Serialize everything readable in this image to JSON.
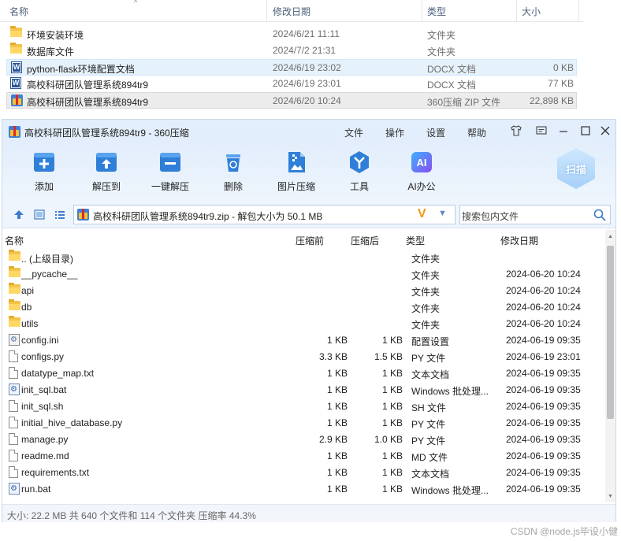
{
  "explorer": {
    "columns": {
      "name": "名称",
      "modified": "修改日期",
      "type": "类型",
      "size": "大小"
    },
    "rows": [
      {
        "icon": "folder-icon",
        "name": "环境安装环境",
        "modified": "2024/6/21 11:11",
        "type": "文件夹",
        "size": ""
      },
      {
        "icon": "folder-icon",
        "name": "数据库文件",
        "modified": "2024/7/2 21:31",
        "type": "文件夹",
        "size": ""
      },
      {
        "icon": "word-doc-icon",
        "name": "python-flask环境配置文档",
        "modified": "2024/6/19 23:02",
        "type": "DOCX 文档",
        "size": "0 KB",
        "selected": true
      },
      {
        "icon": "word-doc-icon",
        "name": "高校科研团队管理系统894tr9",
        "modified": "2024/6/19 23:01",
        "type": "DOCX 文档",
        "size": "77 KB"
      },
      {
        "icon": "zip-archive-icon",
        "name": "高校科研团队管理系统894tr9",
        "modified": "2024/6/20 10:24",
        "type": "360压缩 ZIP 文件",
        "size": "22,898 KB",
        "highlighted": true
      }
    ]
  },
  "app": {
    "title": "高校科研团队管理系统894tr9 - 360压缩",
    "menu": [
      "文件",
      "操作",
      "设置",
      "帮助"
    ],
    "toolbar": [
      {
        "label": "添加",
        "icon": "add-icon"
      },
      {
        "label": "解压到",
        "icon": "extract-to-icon"
      },
      {
        "label": "一键解压",
        "icon": "one-click-extract-icon"
      },
      {
        "label": "删除",
        "icon": "delete-icon"
      },
      {
        "label": "图片压缩",
        "icon": "image-compress-icon"
      },
      {
        "label": "工具",
        "icon": "tools-icon"
      },
      {
        "label": "AI办公",
        "icon": "ai-office-icon"
      }
    ],
    "scan_label": "扫描",
    "address": "高校科研团队管理系统894tr9.zip - 解包大小为 50.1 MB",
    "search_placeholder": "搜索包内文件",
    "columns": {
      "name": "名称",
      "compressed": "压缩前",
      "packed": "压缩后",
      "type": "类型",
      "modified": "修改日期"
    },
    "files": [
      {
        "icon": "folder-icon",
        "name": ".. (上级目录)",
        "before": "",
        "after": "",
        "type": "文件夹",
        "modified": ""
      },
      {
        "icon": "folder-icon",
        "name": "__pycache__",
        "before": "",
        "after": "",
        "type": "文件夹",
        "modified": "2024-06-20 10:24"
      },
      {
        "icon": "folder-icon",
        "name": "api",
        "before": "",
        "after": "",
        "type": "文件夹",
        "modified": "2024-06-20 10:24"
      },
      {
        "icon": "folder-icon",
        "name": "db",
        "before": "",
        "after": "",
        "type": "文件夹",
        "modified": "2024-06-20 10:24"
      },
      {
        "icon": "folder-icon",
        "name": "utils",
        "before": "",
        "after": "",
        "type": "文件夹",
        "modified": "2024-06-20 10:24"
      },
      {
        "icon": "config-file-icon",
        "name": "config.ini",
        "before": "1 KB",
        "after": "1 KB",
        "type": "配置设置",
        "modified": "2024-06-19 09:35"
      },
      {
        "icon": "file-icon",
        "name": "configs.py",
        "before": "3.3 KB",
        "after": "1.5 KB",
        "type": "PY 文件",
        "modified": "2024-06-19 23:01"
      },
      {
        "icon": "file-icon",
        "name": "datatype_map.txt",
        "before": "1 KB",
        "after": "1 KB",
        "type": "文本文档",
        "modified": "2024-06-19 09:35"
      },
      {
        "icon": "batch-file-icon",
        "name": "init_sql.bat",
        "before": "1 KB",
        "after": "1 KB",
        "type": "Windows 批处理...",
        "modified": "2024-06-19 09:35"
      },
      {
        "icon": "file-icon",
        "name": "init_sql.sh",
        "before": "1 KB",
        "after": "1 KB",
        "type": "SH 文件",
        "modified": "2024-06-19 09:35"
      },
      {
        "icon": "file-icon",
        "name": "initial_hive_database.py",
        "before": "1 KB",
        "after": "1 KB",
        "type": "PY 文件",
        "modified": "2024-06-19 09:35"
      },
      {
        "icon": "file-icon",
        "name": "manage.py",
        "before": "2.9 KB",
        "after": "1.0 KB",
        "type": "PY 文件",
        "modified": "2024-06-19 09:35"
      },
      {
        "icon": "file-icon",
        "name": "readme.md",
        "before": "1 KB",
        "after": "1 KB",
        "type": "MD 文件",
        "modified": "2024-06-19 09:35"
      },
      {
        "icon": "file-icon",
        "name": "requirements.txt",
        "before": "1 KB",
        "after": "1 KB",
        "type": "文本文档",
        "modified": "2024-06-19 09:35"
      },
      {
        "icon": "batch-file-icon",
        "name": "run.bat",
        "before": "1 KB",
        "after": "1 KB",
        "type": "Windows 批处理...",
        "modified": "2024-06-19 09:35"
      }
    ],
    "status": "大小: 22.2 MB 共 640 个文件和 114 个文件夹 压缩率 44.3%"
  },
  "watermark": "CSDN @node.js毕设小健",
  "colors": {
    "accent": "#3d7cc9",
    "titlebar": "#e2eefb",
    "vip": "#f29a11"
  }
}
